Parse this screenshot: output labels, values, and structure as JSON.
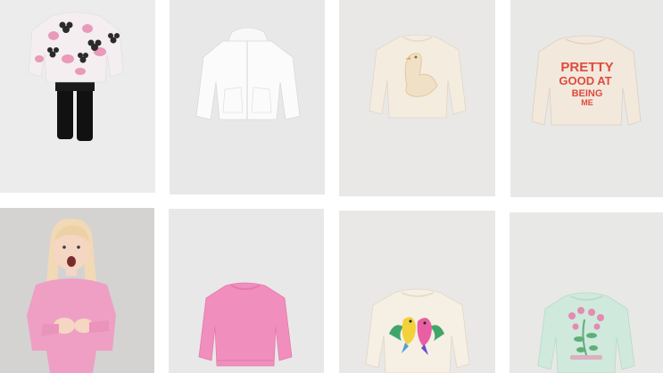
{
  "products": [
    {
      "name": "Minnie Mouse print sweatshirt and leggings set",
      "bg": "#ececec",
      "color": "#f4eef0",
      "accent": "#e89ab8"
    },
    {
      "name": "White zip-up hoodie",
      "bg": "#e9e8e8",
      "color": "#fbfbfb",
      "accent": "#e2e2e2"
    },
    {
      "name": "Cream swan sweatshirt",
      "bg": "#e9e8e7",
      "color": "#f5ece0",
      "accent": "#e2c79a"
    },
    {
      "name": "Cream slogan sweatshirt",
      "bg": "#e8e8e7",
      "color": "#f3e8dc",
      "accent": "#df4a3e"
    },
    {
      "name": "Girl in pink sweatshirt",
      "bg": "#d4d3d2",
      "color": "#ef9fc4",
      "accent": "#f1d9b5"
    },
    {
      "name": "Pink sweatshirt",
      "bg": "#e9e8e8",
      "color": "#f08fbd",
      "accent": "#e47aaa"
    },
    {
      "name": "Cream parrot sweatshirt",
      "bg": "#e9e8e7",
      "color": "#f6efe3",
      "accent": "#f2d13a"
    },
    {
      "name": "Mint floral sweatshirt",
      "bg": "#e8e8e7",
      "color": "#cfe9dc",
      "accent": "#e58ab0"
    }
  ],
  "slogan": [
    "PRETTY",
    "GOOD AT",
    "BEING",
    "ME"
  ]
}
